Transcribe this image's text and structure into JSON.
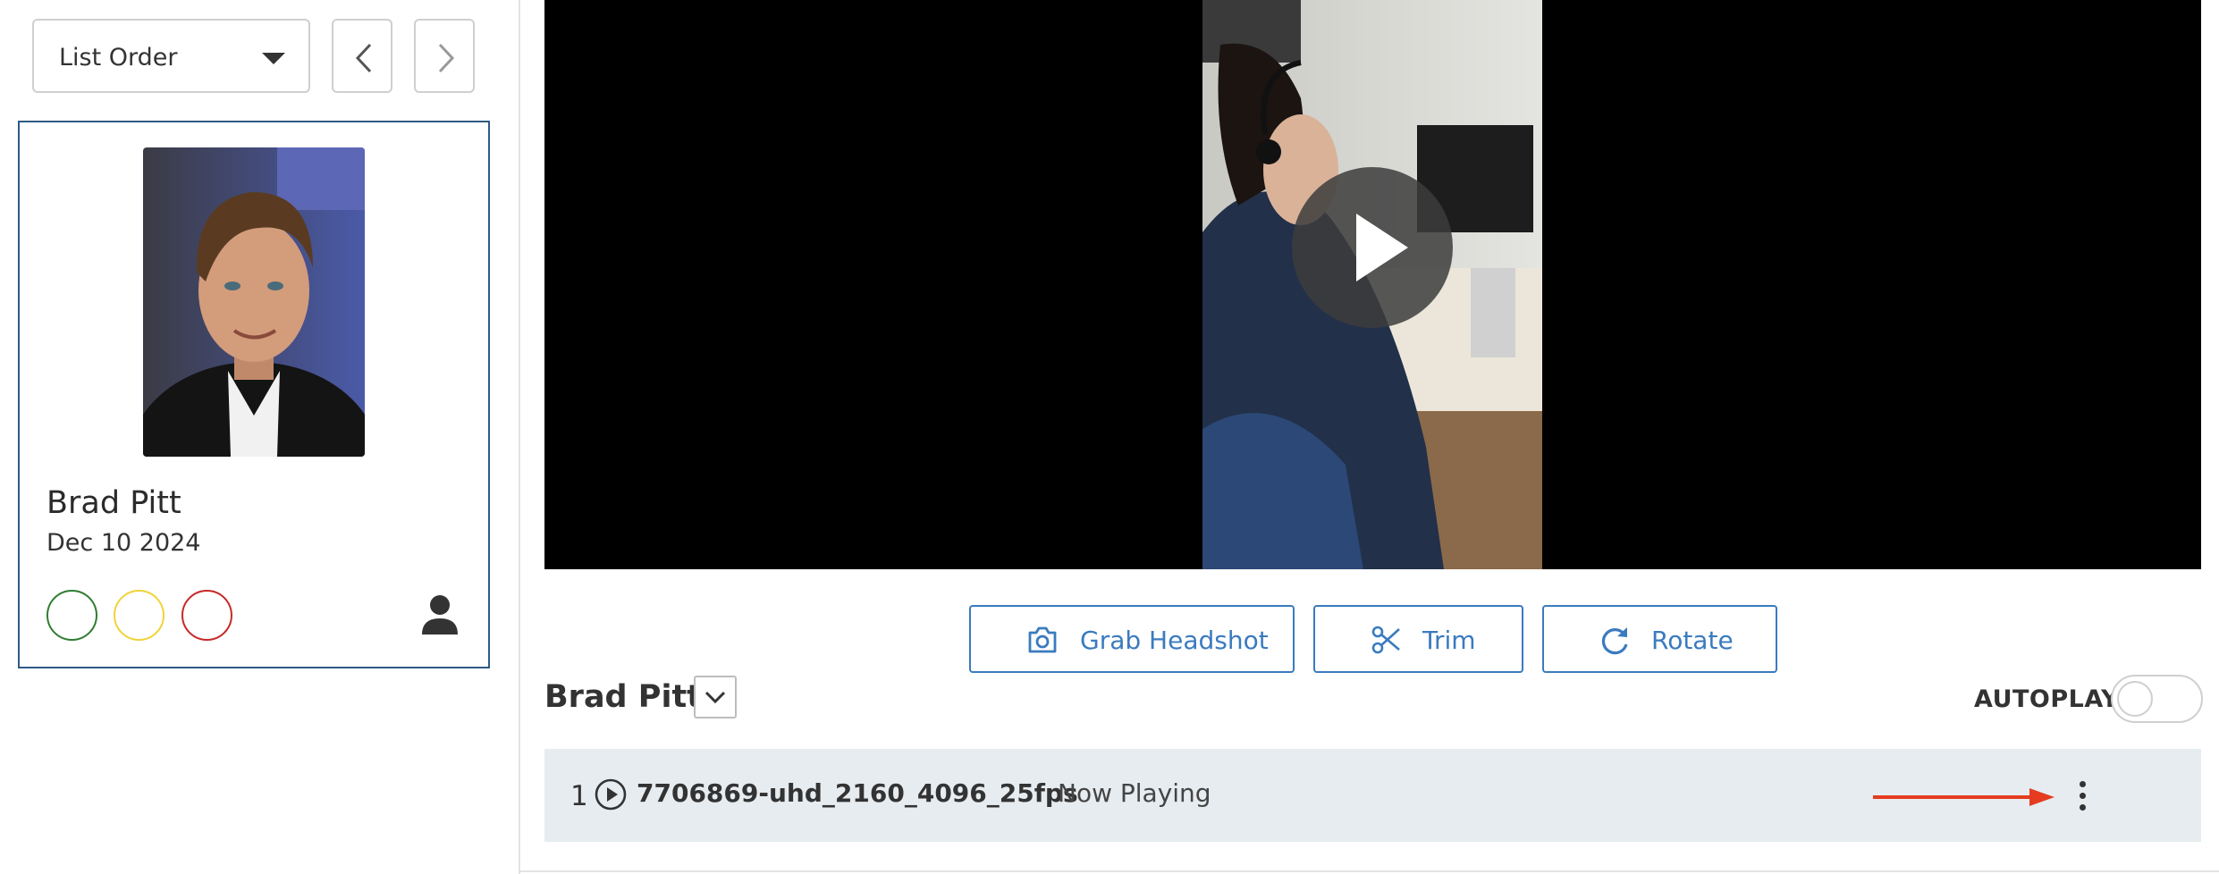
{
  "sidebar": {
    "sort_select": {
      "value": "List Order"
    },
    "prev_button": {
      "icon": "chevron-left-icon"
    },
    "next_button": {
      "icon": "chevron-right-icon"
    },
    "card": {
      "name": "Brad Pitt",
      "date": "Dec 10 2024",
      "status_colors": [
        "#2f7d32",
        "#f0d33a",
        "#c62828"
      ],
      "person_icon": "person-icon"
    }
  },
  "player": {
    "play_icon": "play-icon",
    "buttons": {
      "grab_headshot": "Grab Headshot",
      "trim": "Trim",
      "rotate": "Rotate"
    }
  },
  "playlist": {
    "title": "Brad Pitt",
    "autoplay_label": "AUTOPLAY",
    "autoplay_on": false,
    "items": [
      {
        "index": "1",
        "filename": "7706869-uhd_2160_4096_25fps",
        "status": "Now Playing"
      }
    ]
  },
  "colors": {
    "accent": "#3a7bbf",
    "card_border": "#2f5a84",
    "row_bg": "#e6ecf0",
    "annotation_arrow": "#e53b1f"
  }
}
